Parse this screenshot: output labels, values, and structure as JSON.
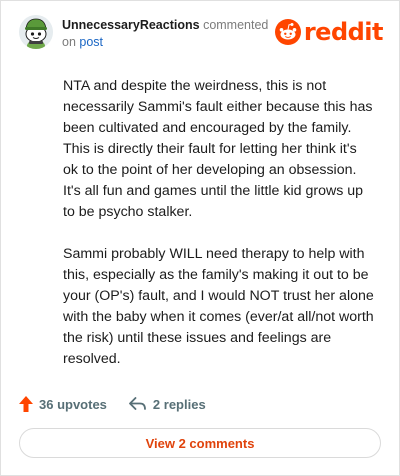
{
  "header": {
    "username": "UnnecessaryReactions",
    "action_text": "commented",
    "on_text": "on",
    "post_link": "post",
    "brand": "reddit"
  },
  "comment": {
    "paragraphs": [
      "NTA and despite the weirdness, this is not necessarily Sammi's fault either because this has been cultivated and encouraged by the family. This is directly their fault for letting her think it's ok to the point of her developing an obsession. It's all fun and games until the little kid grows up to be psycho stalker.",
      "Sammi probably WILL need therapy to help with this, especially as the family's making it out to be your (OP's) fault, and I would NOT trust her alone with the baby when it comes (ever/at all/not worth the risk) until these issues and feelings are resolved."
    ]
  },
  "actions": {
    "upvotes": "36 upvotes",
    "replies": "2 replies",
    "upvote_icon": "upvote-arrow-icon",
    "reply_icon": "reply-arrow-icon"
  },
  "footer": {
    "view_comments": "View 2 comments"
  },
  "colors": {
    "brand": "#ff4500",
    "link": "#1a66c4",
    "muted": "#576f76",
    "view_comments": "#e0430c"
  }
}
